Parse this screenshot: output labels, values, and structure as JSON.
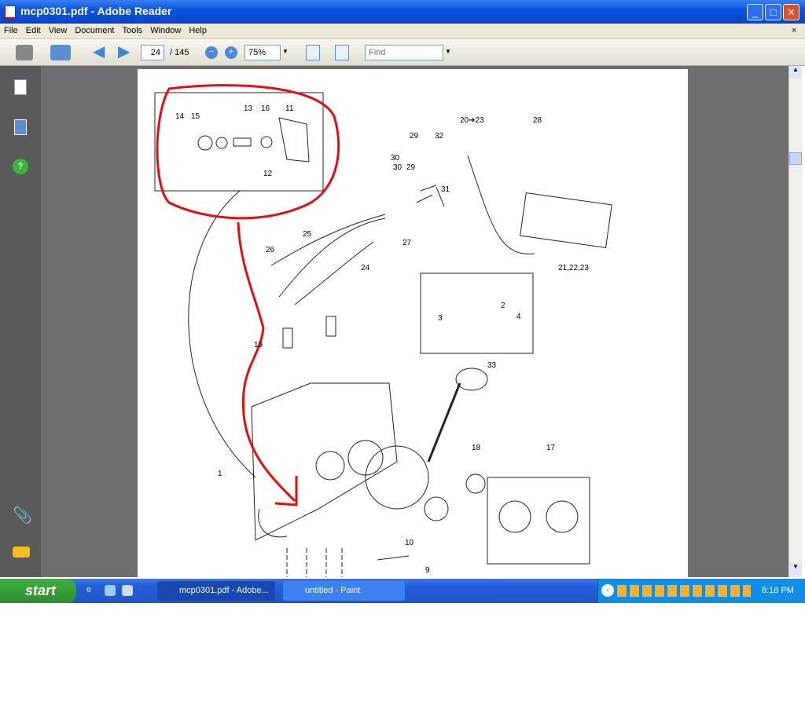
{
  "window": {
    "title": "mcp0301.pdf - Adobe Reader",
    "close_doc": "×"
  },
  "menu": [
    "File",
    "Edit",
    "View",
    "Document",
    "Tools",
    "Window",
    "Help"
  ],
  "toolbar": {
    "page_current": "24",
    "page_total": "/ 145",
    "zoom": "75%",
    "find_placeholder": "Find"
  },
  "diagram": {
    "callouts": [
      "14",
      "15",
      "13",
      "16",
      "11",
      "12",
      "29",
      "32",
      "20➔23",
      "28",
      "30",
      "29",
      "30",
      "31",
      "25",
      "27",
      "26",
      "24",
      "21,22,23",
      "3",
      "2",
      "4",
      "19",
      "33",
      "1",
      "18",
      "17",
      "10",
      "9"
    ]
  },
  "taskbar": {
    "start": "start",
    "tasks": [
      "mcp0301.pdf - Adobe...",
      "untitled - Paint"
    ],
    "clock": "8:18 PM"
  },
  "colors": {
    "annotation": "#e01010",
    "titlebar": "#0a55e0",
    "workspace": "#6e6e6e"
  }
}
